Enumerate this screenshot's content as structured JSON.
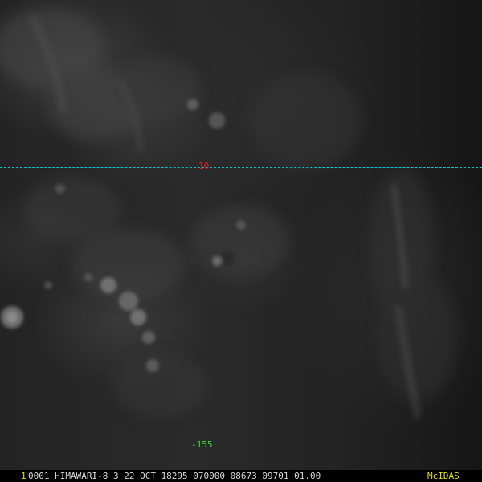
{
  "image": {
    "type": "satellite-visible-imagery",
    "colors": {
      "background": "#1b1b1b",
      "grid_line": "#00c8d0",
      "latitude_label": "#e02020",
      "longitude_label": "#30e030",
      "frame_number": "#e0e000",
      "info_text": "#d8d8d8",
      "brand": "#e0e000"
    }
  },
  "grid": {
    "latitude_label": "10",
    "longitude_label": "-155"
  },
  "status_bar": {
    "frame_number": "1",
    "info": "0001 HIMAWARI-8   3 22 OCT 18295 070000 08673 09701 01.00",
    "brand": "McIDAS"
  }
}
